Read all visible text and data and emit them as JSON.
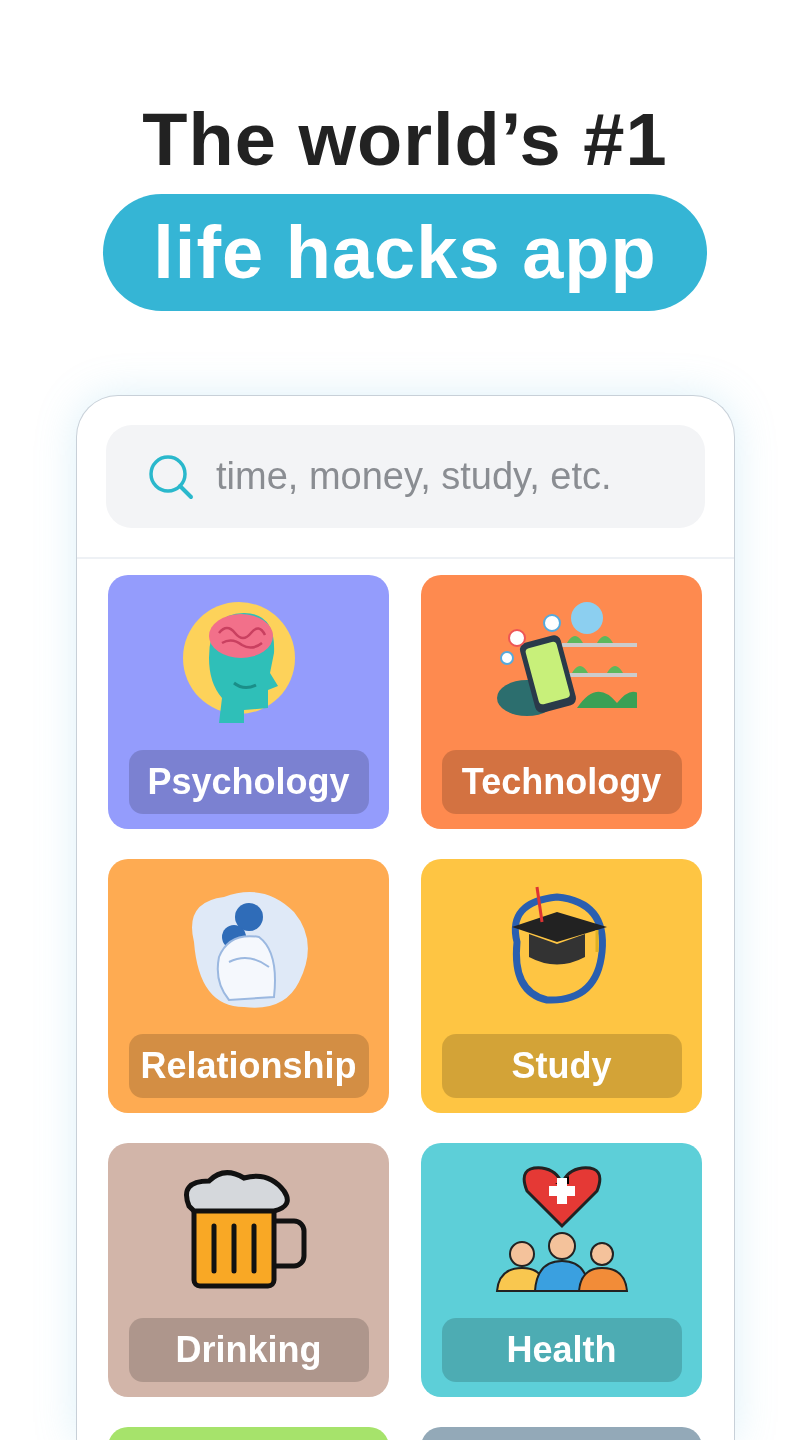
{
  "headline": {
    "line_1": "The world’s #1",
    "line_2": "life hacks app"
  },
  "search": {
    "placeholder": "time, money, study, etc."
  },
  "categories": [
    {
      "label": "Psychology",
      "color": "#949cfc"
    },
    {
      "label": "Technology",
      "color": "#fe8a4f"
    },
    {
      "label": "Relationship",
      "color": "#feab52"
    },
    {
      "label": "Study",
      "color": "#fec543"
    },
    {
      "label": "Drinking",
      "color": "#d2b5a9"
    },
    {
      "label": "Health",
      "color": "#5dcfd8"
    },
    {
      "color": "#a6e36b"
    },
    {
      "color": "#93a9b8"
    }
  ]
}
